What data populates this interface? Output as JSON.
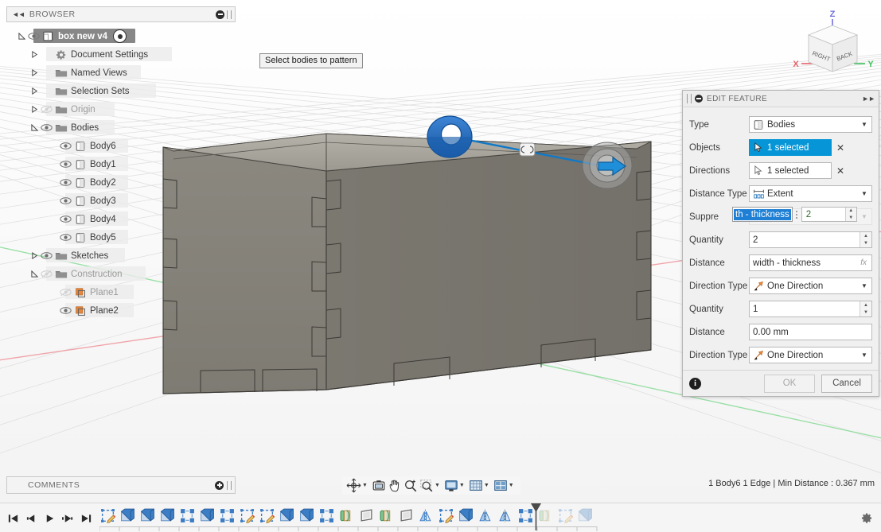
{
  "app": {
    "viewport_tooltip": "Select bodies to pattern"
  },
  "browser": {
    "title": "BROWSER",
    "collapse_icon": "collapse-left-icon",
    "options_icon": "panel-options-icon",
    "items": [
      {
        "label": "box new v4",
        "indent": 0,
        "arrow": "expanded",
        "eye": "visible",
        "icon": "component-icon",
        "root": true,
        "radio": true
      },
      {
        "label": "Document Settings",
        "indent": 1,
        "arrow": "collapsed",
        "eye": "none",
        "icon": "gear-icon"
      },
      {
        "label": "Named Views",
        "indent": 1,
        "arrow": "collapsed",
        "eye": "none",
        "icon": "folder-icon"
      },
      {
        "label": "Selection Sets",
        "indent": 1,
        "arrow": "collapsed",
        "eye": "none",
        "icon": "folder-icon"
      },
      {
        "label": "Origin",
        "indent": 1,
        "arrow": "collapsed",
        "eye": "hidden",
        "icon": "folder-icon"
      },
      {
        "label": "Bodies",
        "indent": 1,
        "arrow": "expanded",
        "eye": "visible",
        "icon": "folder-icon"
      },
      {
        "label": "Body6",
        "indent": 2,
        "arrow": "none",
        "eye": "visible",
        "icon": "body-icon"
      },
      {
        "label": "Body1",
        "indent": 2,
        "arrow": "none",
        "eye": "visible",
        "icon": "body-icon"
      },
      {
        "label": "Body2",
        "indent": 2,
        "arrow": "none",
        "eye": "visible",
        "icon": "body-icon"
      },
      {
        "label": "Body3",
        "indent": 2,
        "arrow": "none",
        "eye": "visible",
        "icon": "body-icon"
      },
      {
        "label": "Body4",
        "indent": 2,
        "arrow": "none",
        "eye": "visible",
        "icon": "body-icon"
      },
      {
        "label": "Body5",
        "indent": 2,
        "arrow": "none",
        "eye": "visible",
        "icon": "body-icon"
      },
      {
        "label": "Sketches",
        "indent": 1,
        "arrow": "collapsed",
        "eye": "visible",
        "icon": "folder-icon"
      },
      {
        "label": "Construction",
        "indent": 1,
        "arrow": "expanded",
        "eye": "hidden",
        "icon": "folder-icon"
      },
      {
        "label": "Plane1",
        "indent": 2,
        "arrow": "none",
        "eye": "hidden",
        "icon": "plane-icon"
      },
      {
        "label": "Plane2",
        "indent": 2,
        "arrow": "none",
        "eye": "visible",
        "icon": "plane-icon"
      }
    ]
  },
  "dialog": {
    "title": "EDIT FEATURE",
    "rows": [
      {
        "label": "Type",
        "kind": "combo",
        "value": "Bodies",
        "icon": "bodies-icon"
      },
      {
        "label": "Objects",
        "kind": "select",
        "value": "1 selected",
        "icon": "cursor-icon",
        "active": true
      },
      {
        "label": "Directions",
        "kind": "select",
        "value": "1 selected",
        "icon": "cursor-icon",
        "active": false
      },
      {
        "label": "Distance Type",
        "kind": "combo",
        "value": "Extent",
        "icon": "extent-icon"
      },
      {
        "label": "Suppre",
        "kind": "suppress",
        "value": ""
      },
      {
        "label": "Quantity",
        "kind": "spin",
        "value": "2"
      },
      {
        "label": "Distance",
        "kind": "text",
        "value": "width - thickness",
        "fx": "fx"
      },
      {
        "label": "Direction Type",
        "kind": "combo",
        "value": "One Direction",
        "icon": "direction-icon"
      },
      {
        "label": "Quantity",
        "kind": "spin",
        "value": "1"
      },
      {
        "label": "Distance",
        "kind": "text",
        "value": "0.00 mm",
        "fx": ""
      },
      {
        "label": "Direction Type",
        "kind": "combo",
        "value": "One Direction",
        "icon": "direction-icon"
      }
    ],
    "inline_edit": {
      "selected_text": "th - thickness",
      "spin_value": "2"
    },
    "ok_label": "OK",
    "cancel_label": "Cancel",
    "ok_disabled": true,
    "accent_color": "#0696d7",
    "selection_highlight": "#1e7fd4"
  },
  "comments": {
    "title": "COMMENTS",
    "add_icon": "add-comment-icon"
  },
  "navbar": {
    "items": [
      {
        "name": "orbit-icon",
        "caret": true
      },
      {
        "name": "look-at-icon",
        "caret": false
      },
      {
        "name": "pan-icon",
        "caret": false
      },
      {
        "name": "zoom-icon",
        "caret": false
      },
      {
        "name": "zoom-window-icon",
        "caret": true
      },
      {
        "name": "display-settings-icon",
        "caret": true
      },
      {
        "name": "grid-snaps-icon",
        "caret": true
      },
      {
        "name": "viewports-icon",
        "caret": true
      }
    ]
  },
  "status": {
    "text": "1 Body6 1 Edge | Min Distance : 0.367 mm"
  },
  "viewcube": {
    "face_left": "RIGHT",
    "face_right": "BACK",
    "axis_x": "X",
    "axis_y": "Y",
    "axis_z": "Z",
    "color_x": "#e8606a",
    "color_y": "#3fc15f",
    "color_z": "#6f6fe0"
  },
  "timeline": {
    "playback": [
      "skip-start-icon",
      "step-back-icon",
      "play-icon",
      "step-forward-icon",
      "skip-end-icon"
    ],
    "features": [
      {
        "type": "sketch-edit",
        "state": "normal"
      },
      {
        "type": "extrude",
        "state": "normal"
      },
      {
        "type": "extrude",
        "state": "normal"
      },
      {
        "type": "extrude",
        "state": "normal"
      },
      {
        "type": "pattern",
        "state": "normal"
      },
      {
        "type": "extrude",
        "state": "normal"
      },
      {
        "type": "pattern",
        "state": "normal"
      },
      {
        "type": "sketch-edit",
        "state": "normal"
      },
      {
        "type": "sketch-edit",
        "state": "normal"
      },
      {
        "type": "extrude",
        "state": "normal"
      },
      {
        "type": "extrude",
        "state": "normal"
      },
      {
        "type": "pattern",
        "state": "normal"
      },
      {
        "type": "combine",
        "state": "normal"
      },
      {
        "type": "plane",
        "state": "normal"
      },
      {
        "type": "combine",
        "state": "normal"
      },
      {
        "type": "plane",
        "state": "normal"
      },
      {
        "type": "mirror",
        "state": "normal"
      },
      {
        "type": "sketch-edit",
        "state": "normal"
      },
      {
        "type": "extrude",
        "state": "normal"
      },
      {
        "type": "mirror",
        "state": "normal"
      },
      {
        "type": "mirror",
        "state": "normal"
      },
      {
        "type": "pattern",
        "state": "normal"
      },
      {
        "type": "combine",
        "state": "dim"
      },
      {
        "type": "sketch-edit",
        "state": "dim"
      },
      {
        "type": "extrude",
        "state": "dim"
      }
    ],
    "marker_after": 22,
    "settings_icon": "gear-icon"
  }
}
